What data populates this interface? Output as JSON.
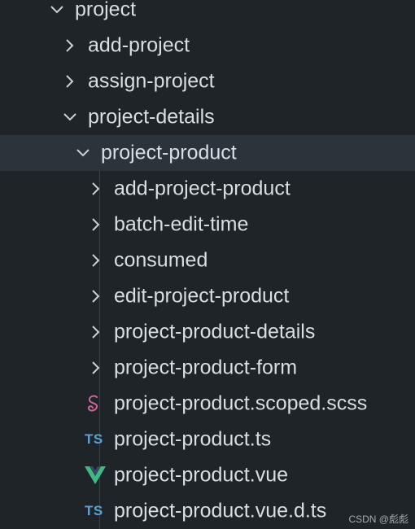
{
  "explorer": {
    "items": [
      {
        "label": "project",
        "kind": "folder",
        "state": "open"
      },
      {
        "label": "add-project",
        "kind": "folder",
        "state": "closed"
      },
      {
        "label": "assign-project",
        "kind": "folder",
        "state": "closed"
      },
      {
        "label": "project-details",
        "kind": "folder",
        "state": "open"
      },
      {
        "label": "project-product",
        "kind": "folder",
        "state": "open",
        "selected": true
      },
      {
        "label": "add-project-product",
        "kind": "folder",
        "state": "closed"
      },
      {
        "label": "batch-edit-time",
        "kind": "folder",
        "state": "closed"
      },
      {
        "label": "consumed",
        "kind": "folder",
        "state": "closed"
      },
      {
        "label": "edit-project-product",
        "kind": "folder",
        "state": "closed"
      },
      {
        "label": "project-product-details",
        "kind": "folder",
        "state": "closed"
      },
      {
        "label": "project-product-form",
        "kind": "folder",
        "state": "closed"
      },
      {
        "label": "project-product.scoped.scss",
        "kind": "file",
        "icon": "sass-icon"
      },
      {
        "label": "project-product.ts",
        "kind": "file",
        "icon": "typescript-icon",
        "badge": "TS"
      },
      {
        "label": "project-product.vue",
        "kind": "file",
        "icon": "vue-icon"
      },
      {
        "label": "project-product.vue.d.ts",
        "kind": "file",
        "icon": "typescript-icon",
        "badge": "TS"
      }
    ]
  },
  "colors": {
    "background": "#1f2428",
    "selected_row": "#2b333b",
    "text": "#d8dee6",
    "chevron": "#c9d1d9",
    "sass": "#cd6799",
    "typescript": "#5aa2d6",
    "vue_outer": "#41b883",
    "vue_inner": "#35495e"
  },
  "watermark": "CSDN @彪彪"
}
